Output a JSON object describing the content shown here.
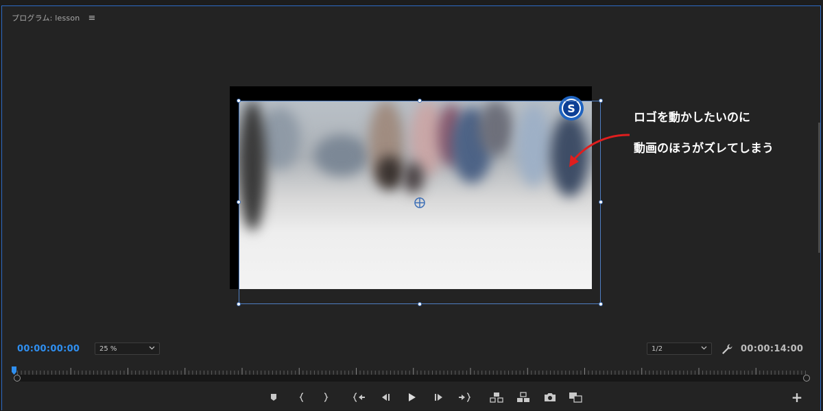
{
  "panel": {
    "title": "プログラム: lesson",
    "menu_icon": "hamburger-menu-icon"
  },
  "annotation": {
    "line1": "ロゴを動かしたいのに",
    "line2": "動画のほうがズレてしまう",
    "color": "#ffffff",
    "arrow_color": "#e01e1e"
  },
  "controls": {
    "current_timecode": "00:00:00:00",
    "zoom_value": "25 %",
    "resolution_value": "1/2",
    "duration_timecode": "00:00:14:00",
    "accent": "#2f8ff0"
  },
  "transport": {
    "buttons": [
      "add-marker",
      "mark-in",
      "mark-out",
      "go-to-in",
      "step-back",
      "play",
      "step-forward",
      "go-to-out",
      "lift",
      "extract",
      "export-frame",
      "comparison-view"
    ],
    "add_button": "+"
  },
  "scrubber": {
    "playhead_position_percent": 0
  }
}
